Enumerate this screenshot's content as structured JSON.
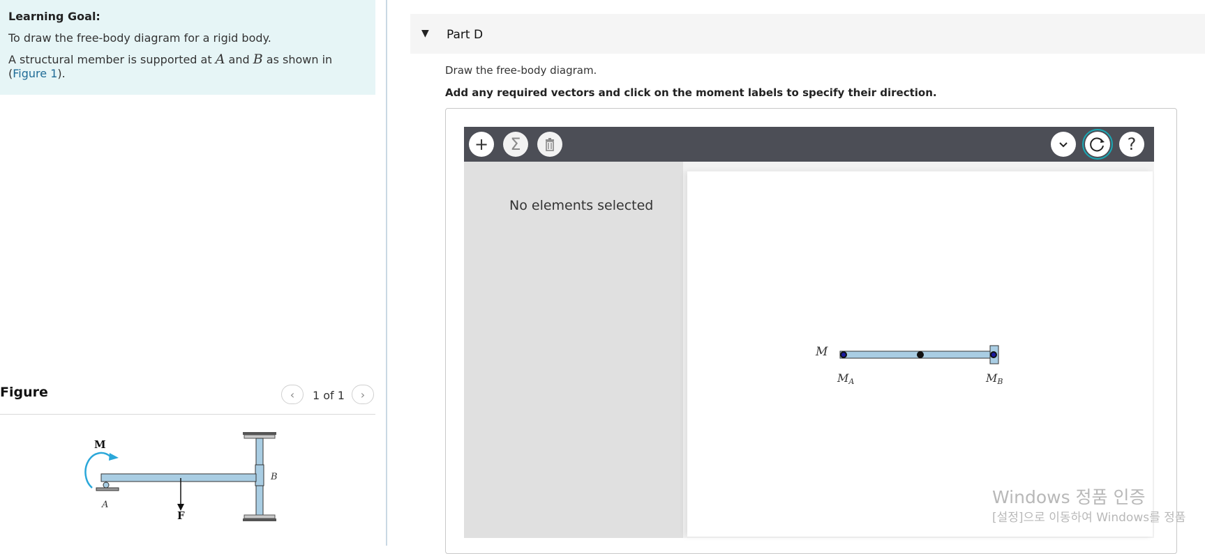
{
  "learning_goal": {
    "title": "Learning Goal:",
    "line1": "To draw the free-body diagram for a rigid body.",
    "line2_pre": "A structural member is supported at ",
    "var_a": "A",
    "line2_mid": " and ",
    "var_b": "B",
    "line2_post": " as shown in (",
    "figure_link": "Figure 1",
    "line2_end": ")."
  },
  "figure_panel": {
    "title": "Figure",
    "prev_icon": "chevron-left-icon",
    "next_icon": "chevron-right-icon",
    "page_indicator": "1 of 1",
    "labels": {
      "moment": "M",
      "support_a": "A",
      "support_b": "B",
      "force": "F"
    },
    "colors": {
      "beam": "#a9cde3",
      "moment_arrow": "#2aa7d9"
    }
  },
  "part": {
    "caret_icon": "caret-down-icon",
    "title": "Part D",
    "instruction": "Draw the free-body diagram.",
    "instruction_bold": "Add any required vectors and click on the moment labels to specify their direction."
  },
  "toolbar": {
    "add_icon": "plus-icon",
    "sum_icon": "sigma-icon",
    "delete_icon": "trash-icon",
    "dropdown_icon": "chevron-down-icon",
    "reset_icon": "refresh-icon",
    "help_icon": "help-icon",
    "colors": {
      "bar": "#4c4e56",
      "selected_outline": "#1aa9b5"
    }
  },
  "properties_pane": {
    "empty_text": "No elements selected"
  },
  "canvas": {
    "labels": {
      "moment": "M",
      "moment_a": "M",
      "sub_a": "A",
      "moment_b": "M",
      "sub_b": "B"
    },
    "colors": {
      "beam": "#a9cde3",
      "node": "#111111",
      "anchor": "#1a1aa0"
    }
  },
  "watermark": {
    "line1": "Windows 정품 인증",
    "line2": "[설정]으로 이동하여 Windows를 정품"
  }
}
